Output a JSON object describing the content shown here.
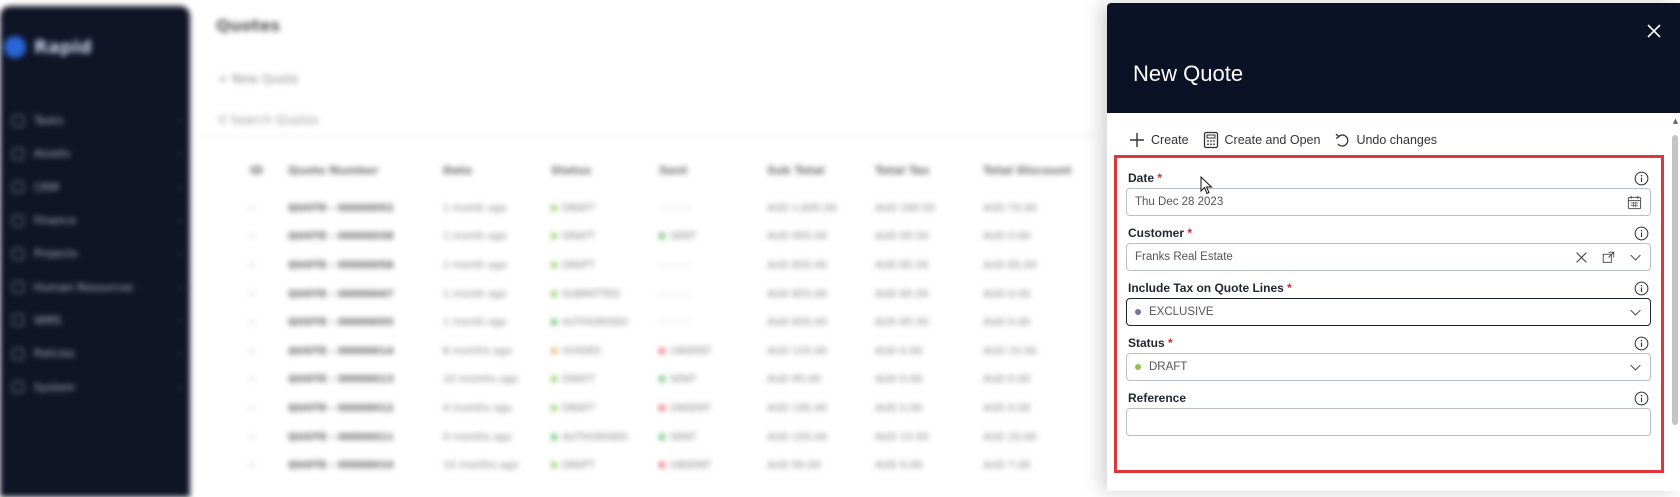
{
  "background": {
    "app_name": "Rapid",
    "page_title": "Quotes",
    "toolbar_new": "New Quote",
    "search_placeholder": "Search Quotes",
    "sidebar_items": [
      "Tasks",
      "Assets",
      "CRM",
      "Finance",
      "Projects",
      "Human Resources",
      "WMS",
      "Policies",
      "System"
    ],
    "columns": [
      "ID",
      "Quote Number",
      "Date",
      "Status",
      "Sent",
      "Sub Total",
      "Total Tax",
      "Total Discount"
    ],
    "rows": [
      {
        "number": "QUOTE - 00000052",
        "date": "1 month ago",
        "status": "DRAFT",
        "status_color": "#7fbf4d",
        "sent": "- - - - -",
        "sent_color": "",
        "sub": "AUD 1,845.00",
        "tax": "AUD 184.50",
        "disc": "AUD 70.00"
      },
      {
        "number": "QUOTE - 00000038",
        "date": "1 month ago",
        "status": "DRAFT",
        "status_color": "#7fbf4d",
        "sent": "SENT",
        "sent_color": "#4caf50",
        "sub": "AUD 955.00",
        "tax": "AUD 95.50",
        "disc": "AUD 0.00"
      },
      {
        "number": "QUOTE - 00000058",
        "date": "1 month ago",
        "status": "DRAFT",
        "status_color": "#7fbf4d",
        "sent": "- - - - -",
        "sent_color": "",
        "sub": "AUD 855.00",
        "tax": "AUD 85.50",
        "disc": "AUD 65.00"
      },
      {
        "number": "QUOTE - 00000047",
        "date": "1 month ago",
        "status": "SUBMITTED",
        "status_color": "#7fbf4d",
        "sent": "- - - - -",
        "sent_color": "",
        "sub": "AUD 855.00",
        "tax": "AUD 85.50",
        "disc": "AUD 0.00"
      },
      {
        "number": "QUOTE - 00000055",
        "date": "1 month ago",
        "status": "AUTHORISED",
        "status_color": "#4caf50",
        "sent": "- - - - -",
        "sent_color": "",
        "sub": "AUD 855.00",
        "tax": "AUD 85.50",
        "disc": "AUD 0.00"
      },
      {
        "number": "QUOTE - 00000014",
        "date": "8 months ago",
        "status": "VOIDED",
        "status_color": "#e8a24a",
        "sent": "UNSENT",
        "sent_color": "#e35050",
        "sub": "AUD 120.00",
        "tax": "AUD 0.00",
        "disc": "AUD 15.00"
      },
      {
        "number": "QUOTE - 00000013",
        "date": "10 months ago",
        "status": "DRAFT",
        "status_color": "#7fbf4d",
        "sent": "SENT",
        "sent_color": "#4caf50",
        "sub": "AUD 95.00",
        "tax": "AUD 0.00",
        "disc": "AUD 0.00"
      },
      {
        "number": "QUOTE - 00000012",
        "date": "9 months ago",
        "status": "DRAFT",
        "status_color": "#7fbf4d",
        "sent": "UNSENT",
        "sent_color": "#e35050",
        "sub": "AUD 195.00",
        "tax": "AUD 0.00",
        "disc": "AUD 0.00"
      },
      {
        "number": "QUOTE - 00000011",
        "date": "9 months ago",
        "status": "AUTHORISED",
        "status_color": "#4caf50",
        "sent": "SENT",
        "sent_color": "#4caf50",
        "sub": "AUD 155.00",
        "tax": "AUD 15.50",
        "disc": "AUD 20.00"
      },
      {
        "number": "QUOTE - 00000010",
        "date": "10 months ago",
        "status": "DRAFT",
        "status_color": "#7fbf4d",
        "sent": "UNSENT",
        "sent_color": "#e35050",
        "sub": "AUD 95.00",
        "tax": "AUD 0.00",
        "disc": "AUD 7.00"
      }
    ]
  },
  "panel": {
    "title": "New Quote",
    "actions": {
      "create": "Create",
      "create_and_open": "Create and Open",
      "undo": "Undo changes"
    },
    "required_mark": "*",
    "fields": {
      "date": {
        "label": "Date",
        "value": "Thu Dec 28 2023"
      },
      "customer": {
        "label": "Customer",
        "value": "Franks Real Estate"
      },
      "tax": {
        "label": "Include Tax on Quote Lines",
        "value": "EXCLUSIVE",
        "dot_color": "#6b7a99"
      },
      "status": {
        "label": "Status",
        "value": "DRAFT",
        "dot_color": "#8bc34a"
      },
      "reference": {
        "label": "Reference",
        "value": ""
      }
    }
  },
  "colors": {
    "panel_header": "#0c1226",
    "highlight_border": "#e0363a",
    "required": "#d62b2b"
  },
  "icons": [
    "close-icon",
    "plus-icon",
    "calculator-icon",
    "undo-icon",
    "info-icon",
    "calendar-icon",
    "clear-icon",
    "open-record-icon",
    "chevron-down-icon"
  ]
}
